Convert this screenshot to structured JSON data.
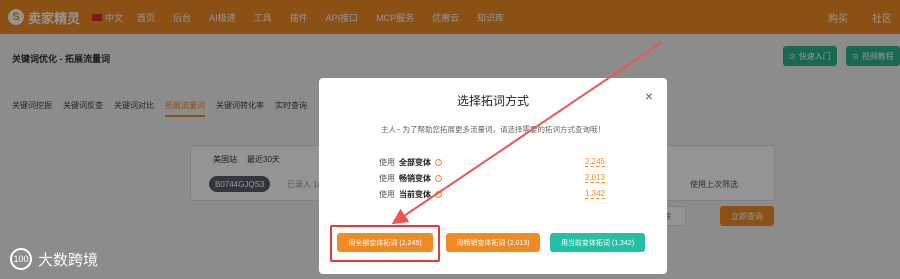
{
  "topnav": {
    "logo_text": "卖家精灵",
    "logo_icon": "S",
    "language": "中文",
    "links": [
      "首页",
      "后台",
      "AI极速",
      "工具",
      "插件",
      "API接口",
      "MCP服务",
      "优惠云",
      "知识库"
    ],
    "right": [
      "购买",
      "社区"
    ]
  },
  "page": {
    "breadcrumb": "关键词优化 - 拓展流量词",
    "quick_entry": "快速入门",
    "video_tutorial": "视频教程",
    "subtabs": [
      "关键词挖掘",
      "关键词反查",
      "关键词对比",
      "拓展流量词",
      "关键词转化率",
      "实时查询"
    ],
    "active_subtab": 3,
    "marketplace": "美国站",
    "period": "最近30天",
    "asin_chip": "B0744GJQS3",
    "input_hint": "已录入 1/",
    "last_filter": "使用上次筛选",
    "clear_label": "清除",
    "query_label": "立即查询"
  },
  "modal": {
    "title": "选择拓词方式",
    "close": "×",
    "description": "主人~ 为了帮助您拓展更多流量词，请选择需要的拓词方式查询哦！",
    "options": [
      {
        "use": "使用",
        "name": "全部变体",
        "value": "2,245"
      },
      {
        "use": "使用",
        "name": "畅销变体",
        "value": "2,013"
      },
      {
        "use": "使用",
        "name": "当前变体",
        "value": "1,342"
      }
    ],
    "buttons": {
      "all": "用全部变体拓词 (2,245)",
      "best": "用畅销变体拓词 (2,013)",
      "current": "用当前变体拓词 (1,342)"
    }
  },
  "watermark": {
    "mark": "100",
    "text": "大数跨境"
  },
  "colors": {
    "brand_orange": "#f08a24",
    "teal": "#25bfa4",
    "highlight_red": "#e53935"
  }
}
